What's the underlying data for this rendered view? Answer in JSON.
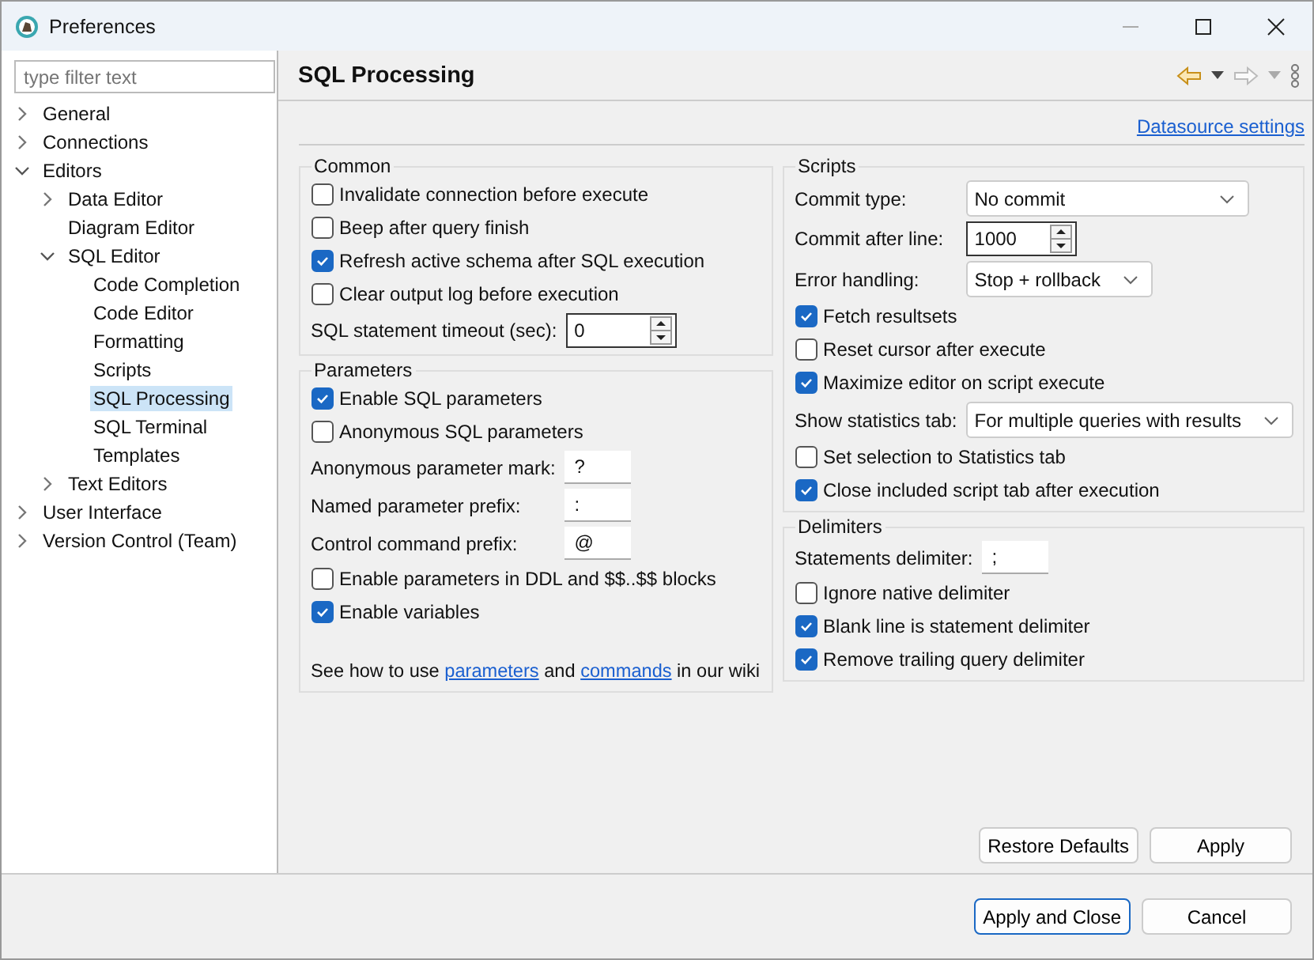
{
  "window": {
    "title": "Preferences"
  },
  "sidebar": {
    "filter": {
      "placeholder": "type filter text"
    },
    "tree": [
      {
        "label": "General",
        "expanded": false,
        "selected": false
      },
      {
        "label": "Connections",
        "expanded": false,
        "selected": false
      },
      {
        "label": "Editors",
        "expanded": true,
        "selected": false,
        "children": [
          {
            "label": "Data Editor",
            "expanded": false,
            "selected": false
          },
          {
            "label": "Diagram Editor",
            "selected": false
          },
          {
            "label": "SQL Editor",
            "expanded": true,
            "selected": false,
            "children": [
              {
                "label": "Code Completion",
                "selected": false
              },
              {
                "label": "Code Editor",
                "selected": false
              },
              {
                "label": "Formatting",
                "selected": false
              },
              {
                "label": "Scripts",
                "selected": false
              },
              {
                "label": "SQL Processing",
                "selected": true
              },
              {
                "label": "SQL Terminal",
                "selected": false
              },
              {
                "label": "Templates",
                "selected": false
              }
            ]
          },
          {
            "label": "Text Editors",
            "expanded": false,
            "selected": false
          }
        ]
      },
      {
        "label": "User Interface",
        "expanded": false,
        "selected": false
      },
      {
        "label": "Version Control (Team)",
        "expanded": false,
        "selected": false
      }
    ]
  },
  "page": {
    "title": "SQL Processing",
    "link": "Datasource settings",
    "columns": [
      [
        {
          "title": "Common",
          "rows": [
            {
              "kind": "checkbox",
              "label": "Invalidate connection before execute",
              "checked": false
            },
            {
              "kind": "checkbox",
              "label": "Beep after query finish",
              "checked": false
            },
            {
              "kind": "checkbox",
              "label": "Refresh active schema after SQL execution",
              "checked": true
            },
            {
              "kind": "checkbox",
              "label": "Clear output log before execution",
              "checked": false
            },
            {
              "kind": "spinner",
              "label": "SQL statement timeout (sec):",
              "value": "0"
            }
          ]
        },
        {
          "title": "Parameters",
          "rows": [
            {
              "kind": "checkbox",
              "label": "Enable SQL parameters",
              "checked": true
            },
            {
              "kind": "checkbox",
              "label": "Anonymous SQL parameters",
              "checked": false
            },
            {
              "kind": "text",
              "label": "Anonymous parameter mark:",
              "value": "?"
            },
            {
              "kind": "text",
              "label": "Named parameter prefix:",
              "value": ":"
            },
            {
              "kind": "text",
              "label": "Control command prefix:",
              "value": "@"
            },
            {
              "kind": "checkbox",
              "label": "Enable parameters in DDL and $$..$$ blocks",
              "checked": false
            },
            {
              "kind": "checkbox",
              "label": "Enable variables",
              "checked": true
            },
            {
              "kind": "note",
              "parts": [
                {
                  "kind": "text",
                  "text": "See how to use "
                },
                {
                  "kind": "link",
                  "text": "parameters"
                },
                {
                  "kind": "text",
                  "text": " and "
                },
                {
                  "kind": "link",
                  "text": "commands"
                },
                {
                  "kind": "text",
                  "text": " in our wiki"
                }
              ]
            }
          ]
        }
      ],
      [
        {
          "title": "Scripts",
          "rows": [
            {
              "kind": "select",
              "label": "Commit type:",
              "value": "No commit"
            },
            {
              "kind": "spinner",
              "label": "Commit after line:",
              "value": "1000"
            },
            {
              "kind": "select",
              "label": "Error handling:",
              "value": "Stop + rollback"
            },
            {
              "kind": "checkbox",
              "label": "Fetch resultsets",
              "checked": true
            },
            {
              "kind": "checkbox",
              "label": "Reset cursor after execute",
              "checked": false
            },
            {
              "kind": "checkbox",
              "label": "Maximize editor on script execute",
              "checked": true
            },
            {
              "kind": "select",
              "label": "Show statistics tab:",
              "value": "For multiple queries with results"
            },
            {
              "kind": "checkbox",
              "label": "Set selection to Statistics tab",
              "checked": false
            },
            {
              "kind": "checkbox",
              "label": "Close included script tab after execution",
              "checked": true
            }
          ]
        },
        {
          "title": "Delimiters",
          "rows": [
            {
              "kind": "text",
              "label": "Statements delimiter:",
              "value": ";"
            },
            {
              "kind": "checkbox",
              "label": "Ignore native delimiter",
              "checked": false
            },
            {
              "kind": "checkbox",
              "label": "Blank line is statement delimiter",
              "checked": true
            },
            {
              "kind": "checkbox",
              "label": "Remove trailing query delimiter",
              "checked": true
            }
          ]
        }
      ]
    ],
    "page_buttons": [
      "Restore Defaults",
      "Apply"
    ]
  },
  "dialog_buttons": [
    {
      "label": "Apply and Close",
      "default": true
    },
    {
      "label": "Cancel",
      "default": false
    }
  ]
}
